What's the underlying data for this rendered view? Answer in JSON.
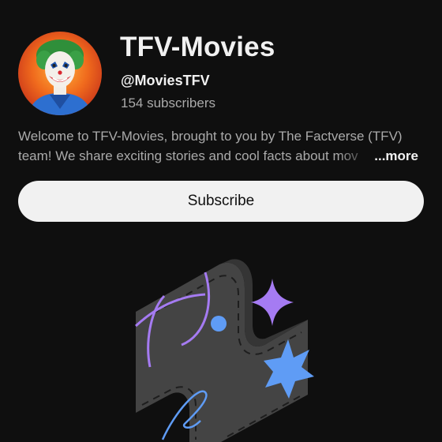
{
  "channel": {
    "name": "TFV-Movies",
    "handle": "@MoviesTFV",
    "subscribers": "154 subscribers",
    "description_line1": "Welcome to TFV-Movies, brought to you by The Factverse (TFV)",
    "description_line2": "team! We share exciting stories and cool facts about mov",
    "more_label": "...more",
    "avatar_icon": "joker-avatar-icon"
  },
  "actions": {
    "subscribe_label": "Subscribe"
  },
  "empty_state": {
    "illustration_icon": "film-strip-sparkle-illustration"
  },
  "colors": {
    "background": "#0f0f0f",
    "primary_text": "#f1f1f1",
    "secondary_text": "#aaaaaa",
    "button_bg": "#f1f1f1",
    "accent_purple": "#a57bf2",
    "accent_blue": "#5f9cf5"
  }
}
